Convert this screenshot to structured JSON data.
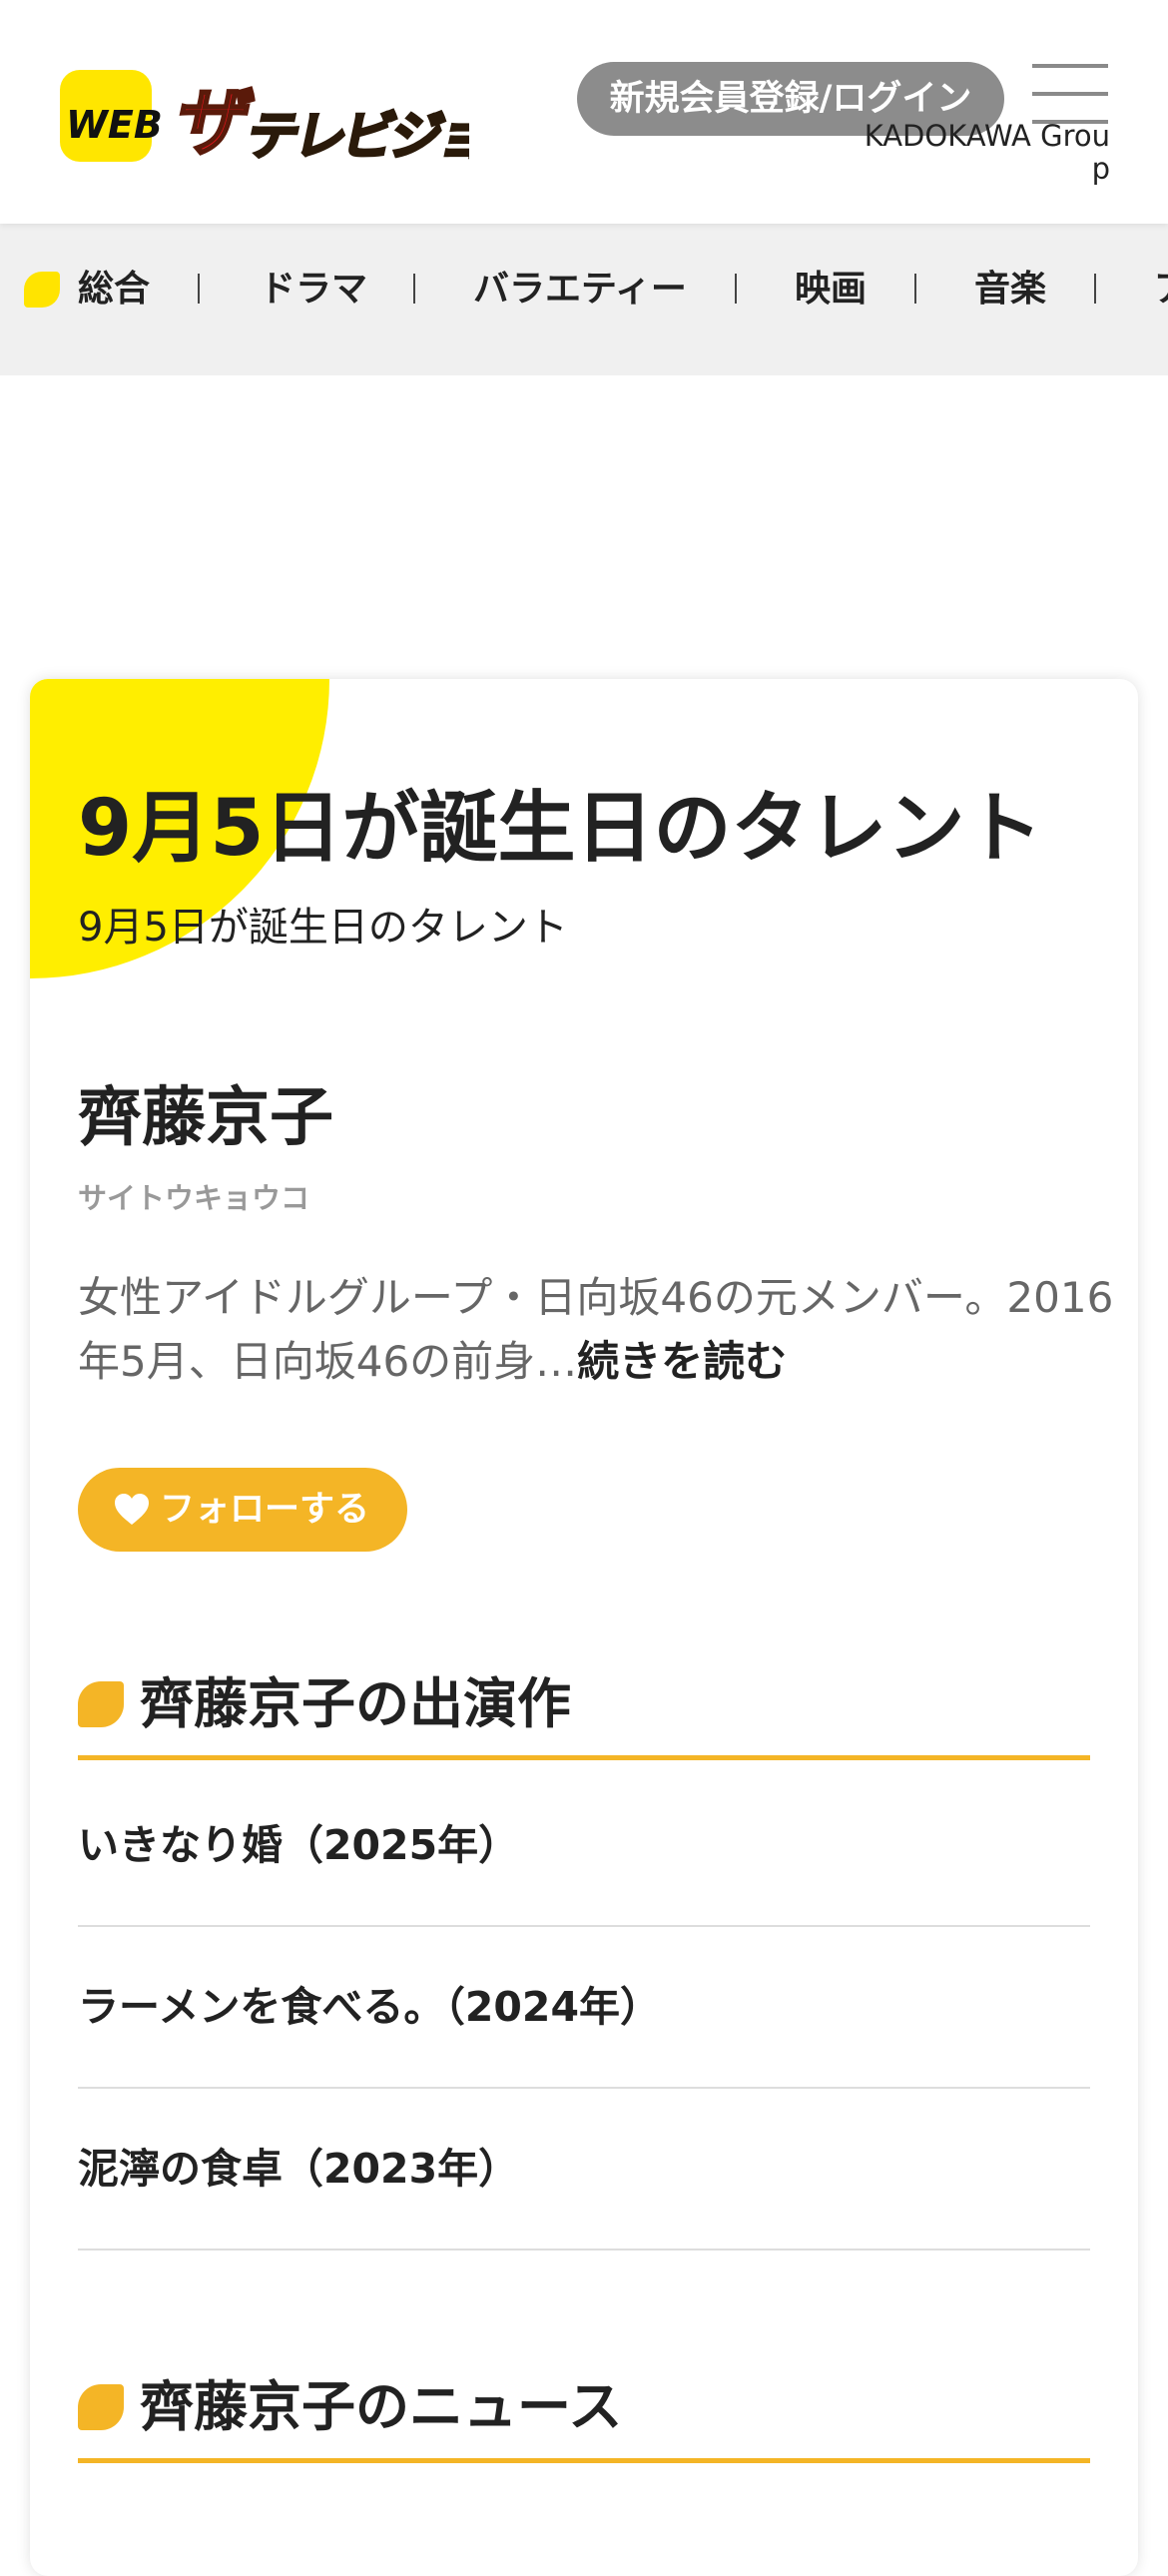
{
  "header": {
    "logo_text": "WEBザテレビジョン",
    "login_label": "新規会員登録/ログイン",
    "group_label": "KADOKAWA Group"
  },
  "nav": {
    "items": [
      {
        "label": "総合"
      },
      {
        "label": "ドラマ"
      },
      {
        "label": "バラエティー"
      },
      {
        "label": "映画"
      },
      {
        "label": "音楽"
      },
      {
        "label": "ア"
      }
    ]
  },
  "card": {
    "title": "9月5日が誕生日のタレント",
    "subtitle": "9月5日が誕生日のタレント"
  },
  "talent": {
    "name": "齊藤京子",
    "kana": "サイトウキョウコ",
    "description": "女性アイドルグループ・日向坂46の元メンバー。2016年5月、日向坂46の前身…",
    "read_more": "続きを読む",
    "follow_label": "フォローする"
  },
  "works_section": {
    "title": "齊藤京子の出演作",
    "items": [
      {
        "title": "いきなり婚（2025年）"
      },
      {
        "title": "ラーメンを食べる。（2024年）"
      },
      {
        "title": "泥濘の食卓（2023年）"
      }
    ]
  },
  "news_section": {
    "title": "齊藤京子のニュース"
  },
  "colors": {
    "accent_yellow": "#ffee00",
    "accent_gold": "#f4b526",
    "logo_red": "#e8121a",
    "logo_brown": "#a07a3a",
    "button_gray": "#8c8c8c"
  }
}
